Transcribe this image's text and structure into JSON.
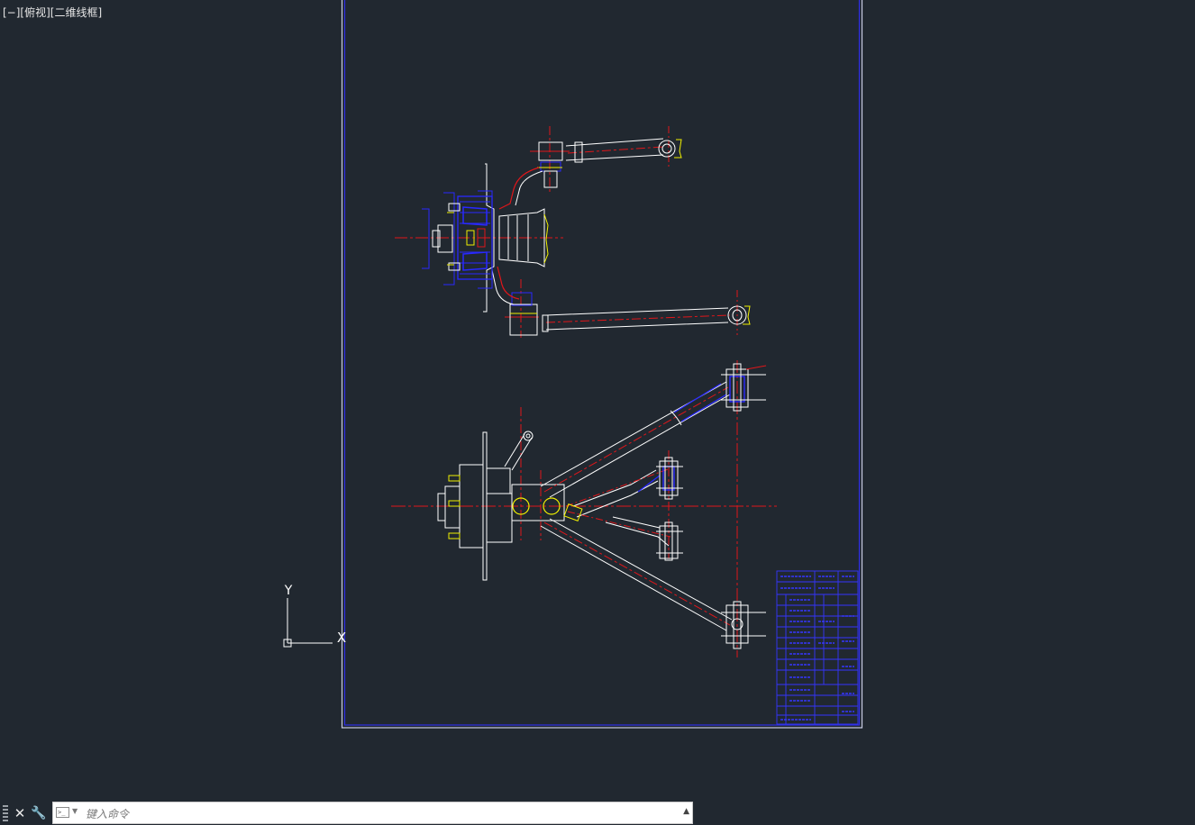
{
  "viewport": {
    "label": "[−][俯视][二维线框]"
  },
  "ucs": {
    "x_label": "X",
    "y_label": "Y"
  },
  "command_line": {
    "placeholder": "键入命令",
    "close_symbol": "✕",
    "customize_symbol": "🔧",
    "history_symbol": "▲"
  },
  "colors": {
    "background": "#212830",
    "sheet_border": "#c9cde3",
    "inner_frame": "#2f2fe6",
    "white_line": "#ffffff",
    "center_line": "#e0161a",
    "hidden_blue": "#2929ff",
    "yellow": "#f0f000",
    "title_block": "#3535ff"
  }
}
